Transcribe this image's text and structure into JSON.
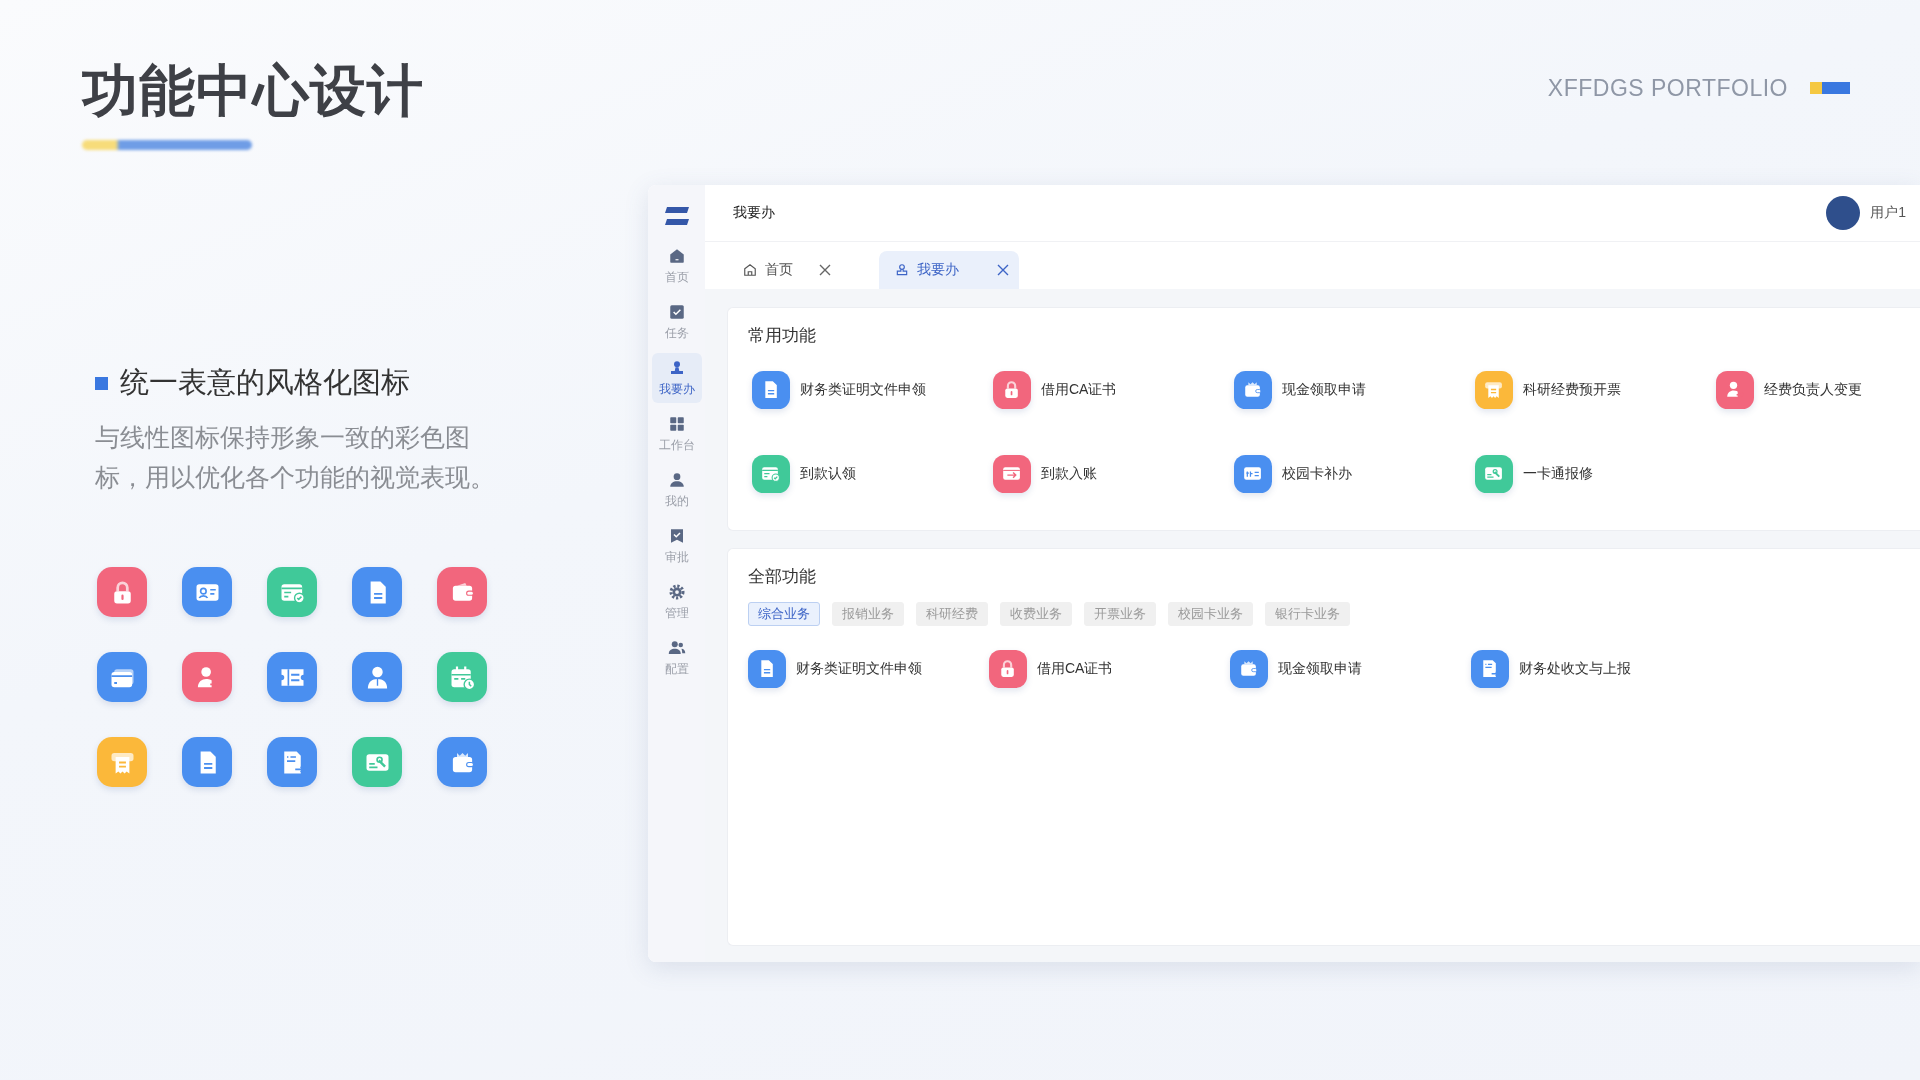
{
  "header": {
    "title": "功能中心设计",
    "brand": "XFFDGS PORTFOLIO"
  },
  "intro": {
    "heading": "统一表意的风格化图标",
    "text": "与线性图标保持形象一致的彩色图标，用以优化各个功能的视觉表现。"
  },
  "icon_showcase": [
    {
      "kind": "lock",
      "color": "#f2667d"
    },
    {
      "kind": "idcard",
      "color": "#4a8ff0"
    },
    {
      "kind": "cardcheck",
      "color": "#40c999"
    },
    {
      "kind": "document",
      "color": "#4a8ff0"
    },
    {
      "kind": "wallet",
      "color": "#f2667d"
    },
    {
      "kind": "bankcard",
      "color": "#4a8ff0"
    },
    {
      "kind": "personswap",
      "color": "#f2667d"
    },
    {
      "kind": "ticket",
      "color": "#4a8ff0"
    },
    {
      "kind": "person",
      "color": "#4a8ff0"
    },
    {
      "kind": "calendar",
      "color": "#40c999"
    },
    {
      "kind": "receipt",
      "color": "#fbb83a"
    },
    {
      "kind": "document",
      "color": "#4a8ff0"
    },
    {
      "kind": "docswap",
      "color": "#4a8ff0"
    },
    {
      "kind": "repair",
      "color": "#40c999"
    },
    {
      "kind": "purse",
      "color": "#4a8ff0"
    }
  ],
  "app": {
    "breadcrumb": "我要办",
    "user": "用户1",
    "sidebar": [
      {
        "kind": "home",
        "label": "首页",
        "selected": false
      },
      {
        "kind": "task",
        "label": "任务",
        "selected": false
      },
      {
        "kind": "stamp",
        "label": "我要办",
        "selected": true
      },
      {
        "kind": "grid",
        "label": "工作台",
        "selected": false
      },
      {
        "kind": "user",
        "label": "我的",
        "selected": false
      },
      {
        "kind": "approve",
        "label": "审批",
        "selected": false
      },
      {
        "kind": "gear",
        "label": "管理",
        "selected": false
      },
      {
        "kind": "users",
        "label": "配置",
        "selected": false
      }
    ],
    "tabs": [
      {
        "kind": "home",
        "label": "首页",
        "selected": false
      },
      {
        "kind": "stamp",
        "label": "我要办",
        "selected": true
      }
    ],
    "common": {
      "title": "常用功能",
      "items": [
        {
          "kind": "document",
          "color": "#4a8ff0",
          "label": "财务类证明文件申领"
        },
        {
          "kind": "lock",
          "color": "#f2667d",
          "label": "借用CA证书"
        },
        {
          "kind": "purse",
          "color": "#4a8ff0",
          "label": "现金领取申请"
        },
        {
          "kind": "receipt",
          "color": "#fbb83a",
          "label": "科研经费预开票"
        },
        {
          "kind": "personswap",
          "color": "#f2667d",
          "label": "经费负责人变更"
        },
        {
          "kind": "cardcheck",
          "color": "#40c999",
          "label": "到款认领"
        },
        {
          "kind": "transfer",
          "color": "#f2667d",
          "label": "到款入账"
        },
        {
          "kind": "campuscard",
          "color": "#4a8ff0",
          "label": "校园卡补办"
        },
        {
          "kind": "repair",
          "color": "#40c999",
          "label": "一卡通报修"
        }
      ]
    },
    "all": {
      "title": "全部功能",
      "filters": [
        {
          "label": "综合业务",
          "selected": true
        },
        {
          "label": "报销业务",
          "selected": false
        },
        {
          "label": "科研经费",
          "selected": false
        },
        {
          "label": "收费业务",
          "selected": false
        },
        {
          "label": "开票业务",
          "selected": false
        },
        {
          "label": "校园卡业务",
          "selected": false
        },
        {
          "label": "银行卡业务",
          "selected": false
        }
      ],
      "items": [
        {
          "kind": "document",
          "color": "#4a8ff0",
          "label": "财务类证明文件申领"
        },
        {
          "kind": "lock",
          "color": "#f2667d",
          "label": "借用CA证书"
        },
        {
          "kind": "purse",
          "color": "#4a8ff0",
          "label": "现金领取申请"
        },
        {
          "kind": "docswap",
          "color": "#4a8ff0",
          "label": "财务处收文与上报"
        }
      ]
    }
  }
}
